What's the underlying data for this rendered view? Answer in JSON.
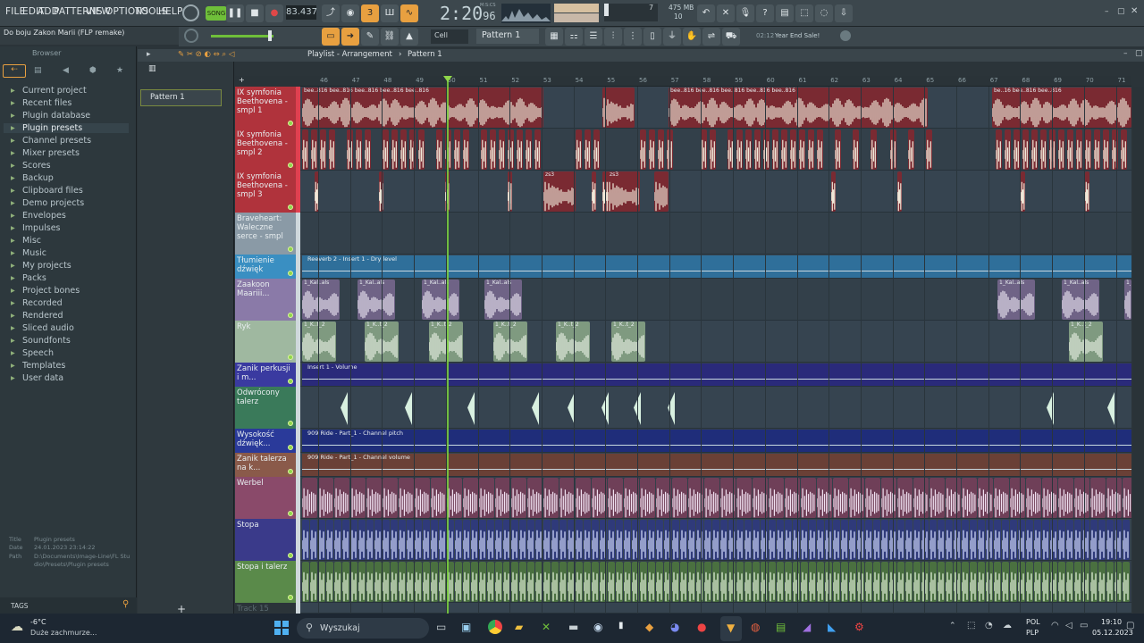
{
  "menu": [
    "FILE",
    "EDIT",
    "ADD",
    "PATTERNS",
    "VIEW",
    "OPTIONS",
    "TOOLS",
    "HELP"
  ],
  "transport": {
    "song_label": "SONG",
    "tempo": "83.437",
    "time": "2:20",
    "time_sub": "96",
    "time_unit": "M:S:CS",
    "cpu_value": "7",
    "mem_value": "475 MB",
    "voices": "10"
  },
  "hint": "Do boju Zakon Marii (FLP remake)",
  "toolbar2": {
    "cell_label": "Cell",
    "pattern_selector": "Pattern 1",
    "news_time": "02:12",
    "news_text": "Year End Sale!"
  },
  "browser": {
    "title": "Browser",
    "items": [
      {
        "label": "Current project",
        "icon": "▸"
      },
      {
        "label": "Recent files",
        "icon": "▸"
      },
      {
        "label": "Plugin database",
        "icon": "▸"
      },
      {
        "label": "Plugin presets",
        "icon": "▸"
      },
      {
        "label": "Channel presets",
        "icon": "▸"
      },
      {
        "label": "Mixer presets",
        "icon": "▸"
      },
      {
        "label": "Scores",
        "icon": "▸"
      },
      {
        "label": "Backup",
        "icon": "▸"
      },
      {
        "label": "Clipboard files",
        "icon": "▸"
      },
      {
        "label": "Demo projects",
        "icon": "▸"
      },
      {
        "label": "Envelopes",
        "icon": "▸"
      },
      {
        "label": "Impulses",
        "icon": "▸"
      },
      {
        "label": "Misc",
        "icon": "▸"
      },
      {
        "label": "Music",
        "icon": "▸"
      },
      {
        "label": "My projects",
        "icon": "▸"
      },
      {
        "label": "Packs",
        "icon": "▸"
      },
      {
        "label": "Project bones",
        "icon": "▸"
      },
      {
        "label": "Recorded",
        "icon": "▸"
      },
      {
        "label": "Rendered",
        "icon": "▸"
      },
      {
        "label": "Sliced audio",
        "icon": "▸"
      },
      {
        "label": "Soundfonts",
        "icon": "▸"
      },
      {
        "label": "Speech",
        "icon": "▸"
      },
      {
        "label": "Templates",
        "icon": "▸"
      },
      {
        "label": "User data",
        "icon": "▸"
      }
    ],
    "info": {
      "title_key": "Title",
      "title_val": "Plugin presets",
      "date_key": "Date",
      "date_val": "24.01.2023 23:14:22",
      "path_key": "Path",
      "path_val": "D:\\Documents\\Image-Line\\FL Studio\\Presets\\Plugin presets"
    },
    "tags_label": "TAGS"
  },
  "patterns": {
    "item": "Pattern 1"
  },
  "playlist": {
    "title": "Playlist - Arrangement",
    "pattern": "Pattern 1"
  },
  "ruler": [
    "46",
    "47",
    "48",
    "49",
    "50",
    "51",
    "52",
    "53",
    "54",
    "55",
    "56",
    "57",
    "58",
    "59",
    "60",
    "61",
    "62",
    "63",
    "64",
    "65",
    "66",
    "67",
    "68",
    "69",
    "70",
    "71"
  ],
  "tracks": [
    {
      "name": "IX symfonia Beethovena - smpl 1",
      "color": "#b0333c",
      "h": 47,
      "kind": "audio",
      "clip": "#7a2a32",
      "clips": [
        [
          0,
          272,
          "bee..816"
        ],
        [
          336,
          290,
          "bee..816"
        ],
        [
          412,
          290,
          "bee..816"
        ],
        [
          774,
          156,
          "be..16"
        ]
      ]
    },
    {
      "name": "IX symfonia Beethovena - smpl 2",
      "color": "#b0333c",
      "h": 47,
      "kind": "chops",
      "clip": "#7a2a32"
    },
    {
      "name": "IX symfonia Beethovena - smpl 3",
      "color": "#b0333c",
      "h": 47,
      "kind": "chops3",
      "clip": "#7a2a32"
    },
    {
      "name": "Braveheart: Waleczne serce - smpl",
      "color": "#8a9aa6",
      "h": 47,
      "kind": "empty"
    },
    {
      "name": "Tłumienie dźwięk",
      "color": "#3a8fc2",
      "h": 27,
      "kind": "auto",
      "auto": "Reeverb 2 - Insert 1 - Dry level",
      "autocolor": "#2f6f9a"
    },
    {
      "name": "Zaakoon Maariii...",
      "color": "#8a7aa8",
      "h": 47,
      "kind": "vocal",
      "clip": "#6f6386",
      "label": "1_Kal..als"
    },
    {
      "name": "Ryk",
      "color": "#9fb8a0",
      "h": 47,
      "kind": "vocal2",
      "clip": "#7f9a80",
      "label": "1_K..t_2"
    },
    {
      "name": "Zanik perkusji i m...",
      "color": "#3a3aa0",
      "h": 27,
      "kind": "auto",
      "auto": "Insert 1 - Volume",
      "autocolor": "#2a2a7a"
    },
    {
      "name": "Odwrócony talerz",
      "color": "#3a7a5a",
      "h": 47,
      "kind": "rev",
      "clip": "#2e5f48"
    },
    {
      "name": "Wysokość dźwięk...",
      "color": "#2a3a9a",
      "h": 27,
      "kind": "auto",
      "auto": "909 Ride - Part_1 - Channel pitch",
      "autocolor": "#1f2d7a"
    },
    {
      "name": "Zanik talerza na k...",
      "color": "#8a5a4a",
      "h": 27,
      "kind": "auto",
      "auto": "909 Ride - Part_1 - Channel volume",
      "autocolor": "#6a4036"
    },
    {
      "name": "Werbel",
      "color": "#8a4a6a",
      "h": 47,
      "kind": "drum",
      "clip": "#6f3f58"
    },
    {
      "name": "Stopa",
      "color": "#3a3a8a",
      "h": 47,
      "kind": "drum2",
      "clip": "#2f3a7a"
    },
    {
      "name": "Stopa i talerz",
      "color": "#5a8a4a",
      "h": 47,
      "kind": "drum3",
      "clip": "#4a7040"
    },
    {
      "name": "Track 15",
      "color": "#2b3439",
      "h": 12,
      "kind": "empty2"
    }
  ],
  "taskbar": {
    "weather_temp": "-6°C",
    "weather_text": "Duże zachmurze...",
    "search": "Wyszukaj",
    "lang1": "POL",
    "lang2": "PLP",
    "time": "19:10",
    "date": "05.12.2023"
  }
}
